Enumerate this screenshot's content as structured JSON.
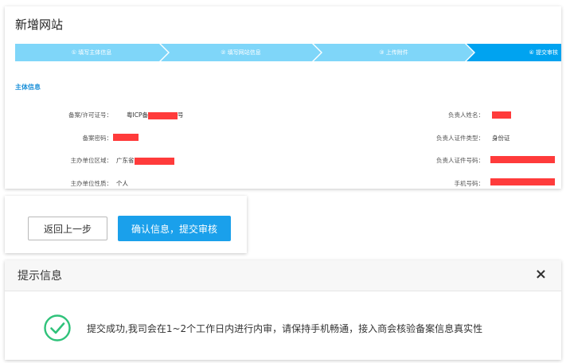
{
  "page_title": "新增网站",
  "steps": [
    {
      "label": "① 填写主体信息",
      "color": "#7fd6f9"
    },
    {
      "label": "② 填写网站信息",
      "color": "#7fd6f9"
    },
    {
      "label": "③ 上传附件",
      "color": "#7fd6f9"
    },
    {
      "label": "④ 提交审核",
      "color": "#00a3f0"
    }
  ],
  "section_title": "主体信息",
  "left_fields": [
    {
      "label": "备案/许可证号：",
      "value_prefix": "粤ICP备",
      "value_suffix": "号"
    },
    {
      "label": "备案密码：",
      "value_prefix": "",
      "value_suffix": ""
    },
    {
      "label": "主办单位区域：",
      "value_prefix": "广东省",
      "value_suffix": ""
    },
    {
      "label": "主办单位性质：",
      "value_prefix": "个人",
      "value_suffix": ""
    }
  ],
  "right_fields": [
    {
      "label": "负责人姓名：",
      "value": ""
    },
    {
      "label": "负责人证件类型：",
      "value": "身份证"
    },
    {
      "label": "负责人证件号码：",
      "value": ""
    },
    {
      "label": "手机号码：",
      "value": ""
    }
  ],
  "buttons": {
    "back": "返回上一步",
    "confirm": "确认信息，提交审核"
  },
  "dialog": {
    "title": "提示信息",
    "close": "×",
    "message": "提交成功,我司会在1~2个工作日内进行内审，请保持手机畅通，接入商会核验备案信息真实性"
  },
  "colors": {
    "accent": "#1aa0eb",
    "redaction": "#ff3b3b",
    "success": "#2fc27a"
  }
}
